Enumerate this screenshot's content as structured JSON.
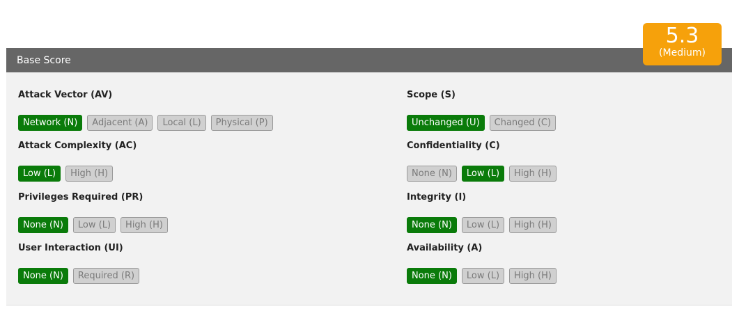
{
  "score": {
    "value": "5.3",
    "rating": "(Medium)",
    "color": "#f6a10b"
  },
  "header": {
    "title": "Base Score"
  },
  "colors": {
    "selected": "#0a7b0a",
    "unselected": "#d0d0d0",
    "header": "#666666"
  },
  "metrics": {
    "av": {
      "label": "Attack Vector (AV)",
      "options": [
        "Network (N)",
        "Adjacent (A)",
        "Local (L)",
        "Physical (P)"
      ],
      "selected": "Network (N)"
    },
    "ac": {
      "label": "Attack Complexity (AC)",
      "options": [
        "Low (L)",
        "High (H)"
      ],
      "selected": "Low (L)"
    },
    "pr": {
      "label": "Privileges Required (PR)",
      "options": [
        "None (N)",
        "Low (L)",
        "High (H)"
      ],
      "selected": "None (N)"
    },
    "ui": {
      "label": "User Interaction (UI)",
      "options": [
        "None (N)",
        "Required (R)"
      ],
      "selected": "None (N)"
    },
    "s": {
      "label": "Scope (S)",
      "options": [
        "Unchanged (U)",
        "Changed (C)"
      ],
      "selected": "Unchanged (U)"
    },
    "c": {
      "label": "Confidentiality (C)",
      "options": [
        "None (N)",
        "Low (L)",
        "High (H)"
      ],
      "selected": "Low (L)"
    },
    "i": {
      "label": "Integrity (I)",
      "options": [
        "None (N)",
        "Low (L)",
        "High (H)"
      ],
      "selected": "None (N)"
    },
    "a": {
      "label": "Availability (A)",
      "options": [
        "None (N)",
        "Low (L)",
        "High (H)"
      ],
      "selected": "None (N)"
    }
  }
}
